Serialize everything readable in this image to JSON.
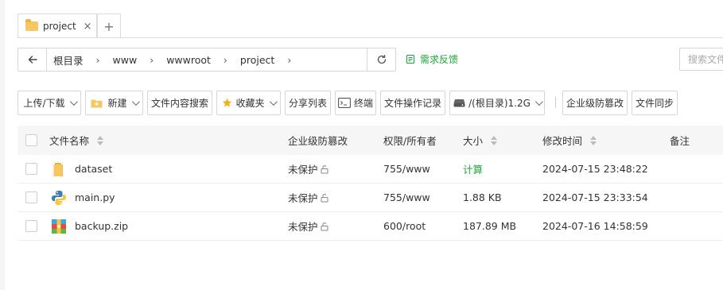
{
  "tabs": [
    {
      "label": "project",
      "icon": "folder-icon",
      "close": "×"
    },
    {
      "label": "+",
      "icon": "plus-icon"
    }
  ],
  "address": {
    "crumbs": [
      "根目录",
      "www",
      "wwwroot",
      "project"
    ],
    "separator": "›"
  },
  "feedback_label": "需求反馈",
  "search": {
    "placeholder": "搜索文件"
  },
  "toolbar": {
    "upload": "上传/下载",
    "new": "新建",
    "content_search": "文件内容搜索",
    "favorites": "收藏夹",
    "share_list": "分享列表",
    "terminal": "终端",
    "operation_log": "文件操作记录",
    "disk": "/(根目录)1.2G",
    "tamper_proof": "企业级防篡改",
    "file_sync": "文件同步"
  },
  "table": {
    "headers": {
      "name": "文件名称",
      "tamper": "企业级防篡改",
      "perm": "权限/所有者",
      "size": "大小",
      "mtime": "修改时间",
      "note": "备注"
    },
    "rows": [
      {
        "name": "dataset",
        "type": "folder",
        "tamper": "未保护",
        "perm": "755/www",
        "size": "计算",
        "mtime": "2024-07-15 23:48:22"
      },
      {
        "name": "main.py",
        "type": "python",
        "tamper": "未保护",
        "perm": "755/www",
        "size": "1.88 KB",
        "mtime": "2024-07-15 23:33:54"
      },
      {
        "name": "backup.zip",
        "type": "zip",
        "tamper": "未保护",
        "perm": "600/root",
        "size": "187.89 MB",
        "mtime": "2024-07-16 14:58:59"
      }
    ]
  },
  "colors": {
    "accent": "#20a53a",
    "folder": "#f6c760"
  }
}
